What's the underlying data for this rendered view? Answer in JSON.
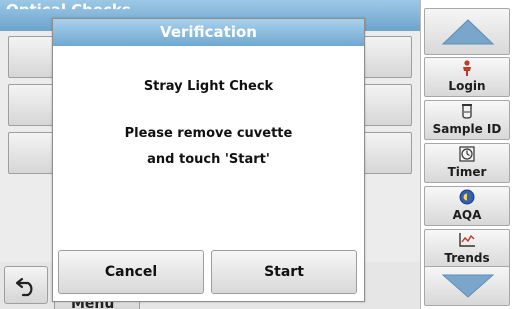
{
  "screen": {
    "title": "Optical Checks",
    "menu_label": "Menu",
    "back_icon": "undo-arrow-icon"
  },
  "side_panel": {
    "scroll_up_icon": "triangle-up-icon",
    "scroll_down_icon": "triangle-down-icon",
    "items": [
      {
        "label": "Login",
        "icon": "person-icon"
      },
      {
        "label": "Sample ID",
        "icon": "sample-vial-icon"
      },
      {
        "label": "Timer",
        "icon": "timer-icon"
      },
      {
        "label": "AQA",
        "icon": "aqa-icon"
      },
      {
        "label": "Trends",
        "icon": "trends-chart-icon"
      }
    ]
  },
  "dialog": {
    "title": "Verification",
    "line1": "Stray Light Check",
    "line2": "Please remove cuvette",
    "line3": "and touch 'Start'",
    "cancel_label": "Cancel",
    "start_label": "Start"
  },
  "colors": {
    "title_bar": "#6da4cd",
    "scroll_arrow": "#7aa6cc"
  }
}
